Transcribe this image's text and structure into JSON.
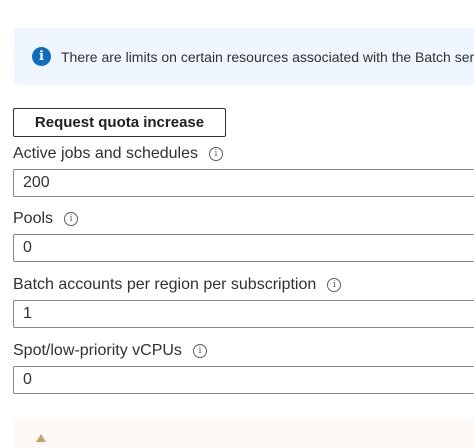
{
  "info_banner": {
    "icon": "info-icon",
    "text": "There are limits on certain resources associated with the Batch service"
  },
  "request_button": {
    "label": "Request quota increase"
  },
  "fields": [
    {
      "label": "Active jobs and schedules",
      "value": "200"
    },
    {
      "label": "Pools",
      "value": "0"
    },
    {
      "label": "Batch accounts per region per subscription",
      "value": "1"
    },
    {
      "label": "Spot/low-priority vCPUs",
      "value": "0"
    }
  ],
  "colors": {
    "info_bg": "#f0f6ff",
    "info_icon": "#0f6cbd",
    "warning_bg": "#fff9f5"
  }
}
